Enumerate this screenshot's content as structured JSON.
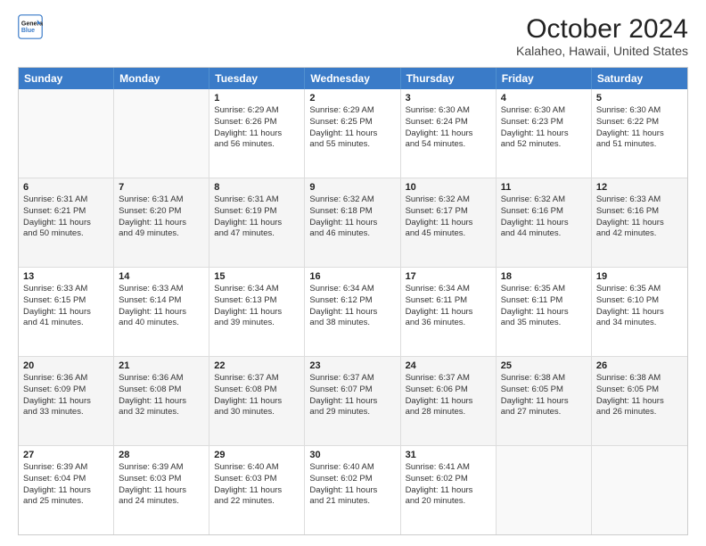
{
  "header": {
    "logo_line1": "General",
    "logo_line2": "Blue",
    "month": "October 2024",
    "location": "Kalaheo, Hawaii, United States"
  },
  "days_of_week": [
    "Sunday",
    "Monday",
    "Tuesday",
    "Wednesday",
    "Thursday",
    "Friday",
    "Saturday"
  ],
  "weeks": [
    [
      {
        "day": "",
        "lines": []
      },
      {
        "day": "",
        "lines": []
      },
      {
        "day": "1",
        "lines": [
          "Sunrise: 6:29 AM",
          "Sunset: 6:26 PM",
          "Daylight: 11 hours",
          "and 56 minutes."
        ]
      },
      {
        "day": "2",
        "lines": [
          "Sunrise: 6:29 AM",
          "Sunset: 6:25 PM",
          "Daylight: 11 hours",
          "and 55 minutes."
        ]
      },
      {
        "day": "3",
        "lines": [
          "Sunrise: 6:30 AM",
          "Sunset: 6:24 PM",
          "Daylight: 11 hours",
          "and 54 minutes."
        ]
      },
      {
        "day": "4",
        "lines": [
          "Sunrise: 6:30 AM",
          "Sunset: 6:23 PM",
          "Daylight: 11 hours",
          "and 52 minutes."
        ]
      },
      {
        "day": "5",
        "lines": [
          "Sunrise: 6:30 AM",
          "Sunset: 6:22 PM",
          "Daylight: 11 hours",
          "and 51 minutes."
        ]
      }
    ],
    [
      {
        "day": "6",
        "lines": [
          "Sunrise: 6:31 AM",
          "Sunset: 6:21 PM",
          "Daylight: 11 hours",
          "and 50 minutes."
        ]
      },
      {
        "day": "7",
        "lines": [
          "Sunrise: 6:31 AM",
          "Sunset: 6:20 PM",
          "Daylight: 11 hours",
          "and 49 minutes."
        ]
      },
      {
        "day": "8",
        "lines": [
          "Sunrise: 6:31 AM",
          "Sunset: 6:19 PM",
          "Daylight: 11 hours",
          "and 47 minutes."
        ]
      },
      {
        "day": "9",
        "lines": [
          "Sunrise: 6:32 AM",
          "Sunset: 6:18 PM",
          "Daylight: 11 hours",
          "and 46 minutes."
        ]
      },
      {
        "day": "10",
        "lines": [
          "Sunrise: 6:32 AM",
          "Sunset: 6:17 PM",
          "Daylight: 11 hours",
          "and 45 minutes."
        ]
      },
      {
        "day": "11",
        "lines": [
          "Sunrise: 6:32 AM",
          "Sunset: 6:16 PM",
          "Daylight: 11 hours",
          "and 44 minutes."
        ]
      },
      {
        "day": "12",
        "lines": [
          "Sunrise: 6:33 AM",
          "Sunset: 6:16 PM",
          "Daylight: 11 hours",
          "and 42 minutes."
        ]
      }
    ],
    [
      {
        "day": "13",
        "lines": [
          "Sunrise: 6:33 AM",
          "Sunset: 6:15 PM",
          "Daylight: 11 hours",
          "and 41 minutes."
        ]
      },
      {
        "day": "14",
        "lines": [
          "Sunrise: 6:33 AM",
          "Sunset: 6:14 PM",
          "Daylight: 11 hours",
          "and 40 minutes."
        ]
      },
      {
        "day": "15",
        "lines": [
          "Sunrise: 6:34 AM",
          "Sunset: 6:13 PM",
          "Daylight: 11 hours",
          "and 39 minutes."
        ]
      },
      {
        "day": "16",
        "lines": [
          "Sunrise: 6:34 AM",
          "Sunset: 6:12 PM",
          "Daylight: 11 hours",
          "and 38 minutes."
        ]
      },
      {
        "day": "17",
        "lines": [
          "Sunrise: 6:34 AM",
          "Sunset: 6:11 PM",
          "Daylight: 11 hours",
          "and 36 minutes."
        ]
      },
      {
        "day": "18",
        "lines": [
          "Sunrise: 6:35 AM",
          "Sunset: 6:11 PM",
          "Daylight: 11 hours",
          "and 35 minutes."
        ]
      },
      {
        "day": "19",
        "lines": [
          "Sunrise: 6:35 AM",
          "Sunset: 6:10 PM",
          "Daylight: 11 hours",
          "and 34 minutes."
        ]
      }
    ],
    [
      {
        "day": "20",
        "lines": [
          "Sunrise: 6:36 AM",
          "Sunset: 6:09 PM",
          "Daylight: 11 hours",
          "and 33 minutes."
        ]
      },
      {
        "day": "21",
        "lines": [
          "Sunrise: 6:36 AM",
          "Sunset: 6:08 PM",
          "Daylight: 11 hours",
          "and 32 minutes."
        ]
      },
      {
        "day": "22",
        "lines": [
          "Sunrise: 6:37 AM",
          "Sunset: 6:08 PM",
          "Daylight: 11 hours",
          "and 30 minutes."
        ]
      },
      {
        "day": "23",
        "lines": [
          "Sunrise: 6:37 AM",
          "Sunset: 6:07 PM",
          "Daylight: 11 hours",
          "and 29 minutes."
        ]
      },
      {
        "day": "24",
        "lines": [
          "Sunrise: 6:37 AM",
          "Sunset: 6:06 PM",
          "Daylight: 11 hours",
          "and 28 minutes."
        ]
      },
      {
        "day": "25",
        "lines": [
          "Sunrise: 6:38 AM",
          "Sunset: 6:05 PM",
          "Daylight: 11 hours",
          "and 27 minutes."
        ]
      },
      {
        "day": "26",
        "lines": [
          "Sunrise: 6:38 AM",
          "Sunset: 6:05 PM",
          "Daylight: 11 hours",
          "and 26 minutes."
        ]
      }
    ],
    [
      {
        "day": "27",
        "lines": [
          "Sunrise: 6:39 AM",
          "Sunset: 6:04 PM",
          "Daylight: 11 hours",
          "and 25 minutes."
        ]
      },
      {
        "day": "28",
        "lines": [
          "Sunrise: 6:39 AM",
          "Sunset: 6:03 PM",
          "Daylight: 11 hours",
          "and 24 minutes."
        ]
      },
      {
        "day": "29",
        "lines": [
          "Sunrise: 6:40 AM",
          "Sunset: 6:03 PM",
          "Daylight: 11 hours",
          "and 22 minutes."
        ]
      },
      {
        "day": "30",
        "lines": [
          "Sunrise: 6:40 AM",
          "Sunset: 6:02 PM",
          "Daylight: 11 hours",
          "and 21 minutes."
        ]
      },
      {
        "day": "31",
        "lines": [
          "Sunrise: 6:41 AM",
          "Sunset: 6:02 PM",
          "Daylight: 11 hours",
          "and 20 minutes."
        ]
      },
      {
        "day": "",
        "lines": []
      },
      {
        "day": "",
        "lines": []
      }
    ]
  ]
}
